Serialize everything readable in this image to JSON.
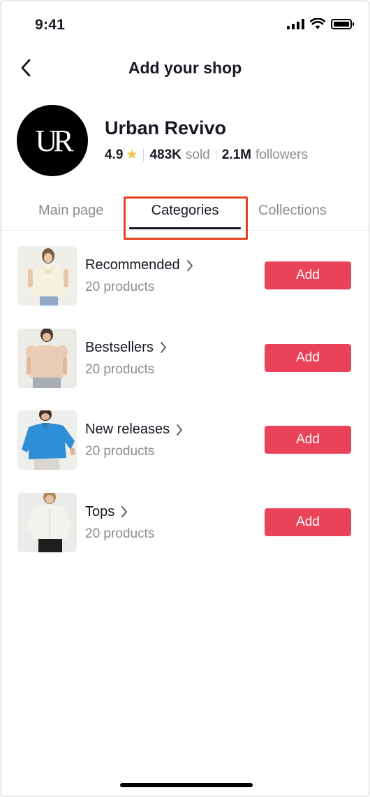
{
  "status_bar": {
    "time": "9:41"
  },
  "header": {
    "title": "Add your shop"
  },
  "shop": {
    "logo_text": "UR",
    "name": "Urban Revivo",
    "rating": "4.9",
    "sold_value": "483K",
    "sold_label": "sold",
    "followers_value": "2.1M",
    "followers_label": "followers"
  },
  "tabs": {
    "main": "Main page",
    "categories": "Categories",
    "collections": "Collections",
    "active": "Categories"
  },
  "categories": [
    {
      "name": "Recommended",
      "count": "20 products",
      "button": "Add",
      "thumb": "cream-sleeveless-blouse"
    },
    {
      "name": "Bestsellers",
      "count": "20 products",
      "button": "Add",
      "thumb": "beige-puff-sleeve-top"
    },
    {
      "name": "New releases",
      "count": "20 products",
      "button": "Add",
      "thumb": "blue-shirt"
    },
    {
      "name": "Tops",
      "count": "20 products",
      "button": "Add",
      "thumb": "white-shirt"
    }
  ],
  "colors": {
    "accent": "#ea4359",
    "highlight_box": "#e2431e",
    "star": "#f6c443",
    "muted_text": "#8a8b91"
  }
}
